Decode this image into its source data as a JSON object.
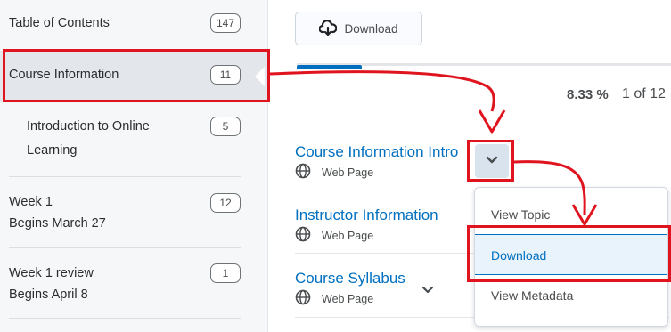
{
  "sidebar": {
    "items": [
      {
        "label": "Table of Contents",
        "count": "147"
      },
      {
        "label": "Course Information",
        "count": "11"
      },
      {
        "label": "Introduction to Online",
        "label2": "Learning",
        "count": "5"
      },
      {
        "label": "Week 1",
        "sublabel": "Begins March 27",
        "count": "12"
      },
      {
        "label": "Week 1 review",
        "sublabel": "Begins April 8",
        "count": "1"
      }
    ]
  },
  "toolbar": {
    "download_label": "Download",
    "download_icon": "cloud-download-icon"
  },
  "progress": {
    "percent_label": "8.33 %",
    "count_label": "1 of 12",
    "fraction": 0.0833
  },
  "topics": [
    {
      "title": "Course Information Intro",
      "type": "Web Page"
    },
    {
      "title": "Instructor Information",
      "type": "Web Page"
    },
    {
      "title": "Course Syllabus",
      "type": "Web Page"
    }
  ],
  "context_menu": {
    "items": [
      {
        "label": "View Topic"
      },
      {
        "label": "Download"
      },
      {
        "label": "View Metadata"
      }
    ]
  },
  "colors": {
    "accent": "#006fbf",
    "annotation": "#e0141e",
    "sidebar_bg": "#f6f7f8"
  }
}
